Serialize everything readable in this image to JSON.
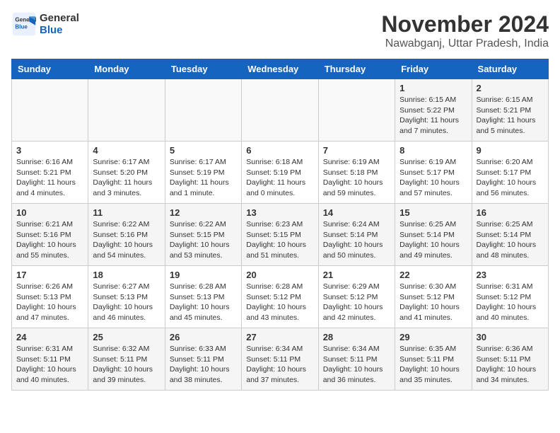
{
  "logo": {
    "line1": "General",
    "line2": "Blue"
  },
  "title": "November 2024",
  "location": "Nawabganj, Uttar Pradesh, India",
  "weekdays": [
    "Sunday",
    "Monday",
    "Tuesday",
    "Wednesday",
    "Thursday",
    "Friday",
    "Saturday"
  ],
  "weeks": [
    [
      {
        "day": "",
        "info": ""
      },
      {
        "day": "",
        "info": ""
      },
      {
        "day": "",
        "info": ""
      },
      {
        "day": "",
        "info": ""
      },
      {
        "day": "",
        "info": ""
      },
      {
        "day": "1",
        "info": "Sunrise: 6:15 AM\nSunset: 5:22 PM\nDaylight: 11 hours\nand 7 minutes."
      },
      {
        "day": "2",
        "info": "Sunrise: 6:15 AM\nSunset: 5:21 PM\nDaylight: 11 hours\nand 5 minutes."
      }
    ],
    [
      {
        "day": "3",
        "info": "Sunrise: 6:16 AM\nSunset: 5:21 PM\nDaylight: 11 hours\nand 4 minutes."
      },
      {
        "day": "4",
        "info": "Sunrise: 6:17 AM\nSunset: 5:20 PM\nDaylight: 11 hours\nand 3 minutes."
      },
      {
        "day": "5",
        "info": "Sunrise: 6:17 AM\nSunset: 5:19 PM\nDaylight: 11 hours\nand 1 minute."
      },
      {
        "day": "6",
        "info": "Sunrise: 6:18 AM\nSunset: 5:19 PM\nDaylight: 11 hours\nand 0 minutes."
      },
      {
        "day": "7",
        "info": "Sunrise: 6:19 AM\nSunset: 5:18 PM\nDaylight: 10 hours\nand 59 minutes."
      },
      {
        "day": "8",
        "info": "Sunrise: 6:19 AM\nSunset: 5:17 PM\nDaylight: 10 hours\nand 57 minutes."
      },
      {
        "day": "9",
        "info": "Sunrise: 6:20 AM\nSunset: 5:17 PM\nDaylight: 10 hours\nand 56 minutes."
      }
    ],
    [
      {
        "day": "10",
        "info": "Sunrise: 6:21 AM\nSunset: 5:16 PM\nDaylight: 10 hours\nand 55 minutes."
      },
      {
        "day": "11",
        "info": "Sunrise: 6:22 AM\nSunset: 5:16 PM\nDaylight: 10 hours\nand 54 minutes."
      },
      {
        "day": "12",
        "info": "Sunrise: 6:22 AM\nSunset: 5:15 PM\nDaylight: 10 hours\nand 53 minutes."
      },
      {
        "day": "13",
        "info": "Sunrise: 6:23 AM\nSunset: 5:15 PM\nDaylight: 10 hours\nand 51 minutes."
      },
      {
        "day": "14",
        "info": "Sunrise: 6:24 AM\nSunset: 5:14 PM\nDaylight: 10 hours\nand 50 minutes."
      },
      {
        "day": "15",
        "info": "Sunrise: 6:25 AM\nSunset: 5:14 PM\nDaylight: 10 hours\nand 49 minutes."
      },
      {
        "day": "16",
        "info": "Sunrise: 6:25 AM\nSunset: 5:14 PM\nDaylight: 10 hours\nand 48 minutes."
      }
    ],
    [
      {
        "day": "17",
        "info": "Sunrise: 6:26 AM\nSunset: 5:13 PM\nDaylight: 10 hours\nand 47 minutes."
      },
      {
        "day": "18",
        "info": "Sunrise: 6:27 AM\nSunset: 5:13 PM\nDaylight: 10 hours\nand 46 minutes."
      },
      {
        "day": "19",
        "info": "Sunrise: 6:28 AM\nSunset: 5:13 PM\nDaylight: 10 hours\nand 45 minutes."
      },
      {
        "day": "20",
        "info": "Sunrise: 6:28 AM\nSunset: 5:12 PM\nDaylight: 10 hours\nand 43 minutes."
      },
      {
        "day": "21",
        "info": "Sunrise: 6:29 AM\nSunset: 5:12 PM\nDaylight: 10 hours\nand 42 minutes."
      },
      {
        "day": "22",
        "info": "Sunrise: 6:30 AM\nSunset: 5:12 PM\nDaylight: 10 hours\nand 41 minutes."
      },
      {
        "day": "23",
        "info": "Sunrise: 6:31 AM\nSunset: 5:12 PM\nDaylight: 10 hours\nand 40 minutes."
      }
    ],
    [
      {
        "day": "24",
        "info": "Sunrise: 6:31 AM\nSunset: 5:11 PM\nDaylight: 10 hours\nand 40 minutes."
      },
      {
        "day": "25",
        "info": "Sunrise: 6:32 AM\nSunset: 5:11 PM\nDaylight: 10 hours\nand 39 minutes."
      },
      {
        "day": "26",
        "info": "Sunrise: 6:33 AM\nSunset: 5:11 PM\nDaylight: 10 hours\nand 38 minutes."
      },
      {
        "day": "27",
        "info": "Sunrise: 6:34 AM\nSunset: 5:11 PM\nDaylight: 10 hours\nand 37 minutes."
      },
      {
        "day": "28",
        "info": "Sunrise: 6:34 AM\nSunset: 5:11 PM\nDaylight: 10 hours\nand 36 minutes."
      },
      {
        "day": "29",
        "info": "Sunrise: 6:35 AM\nSunset: 5:11 PM\nDaylight: 10 hours\nand 35 minutes."
      },
      {
        "day": "30",
        "info": "Sunrise: 6:36 AM\nSunset: 5:11 PM\nDaylight: 10 hours\nand 34 minutes."
      }
    ]
  ]
}
